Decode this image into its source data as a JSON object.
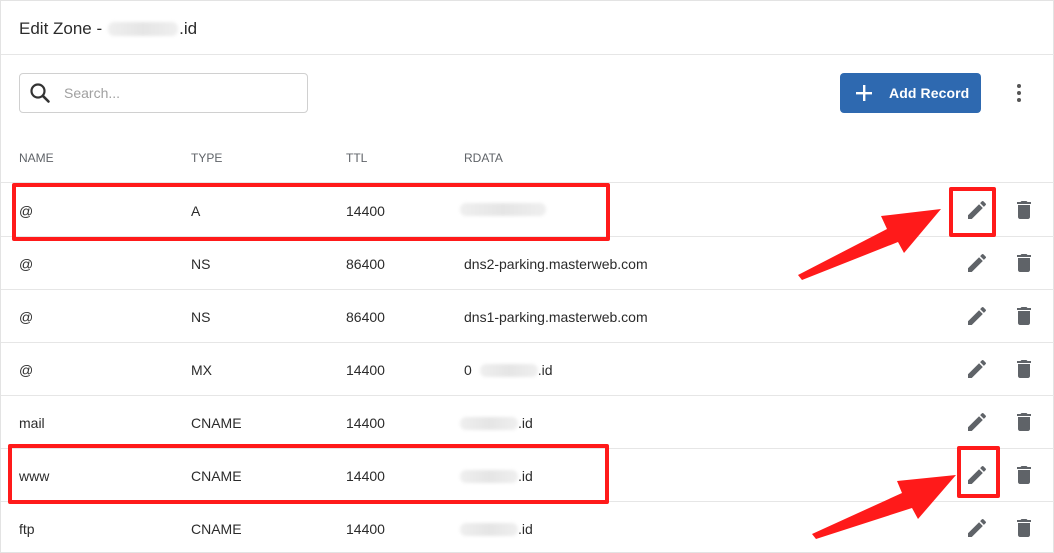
{
  "header": {
    "title_prefix": "Edit Zone - ",
    "title_suffix": ".id"
  },
  "search": {
    "placeholder": "Search...",
    "icon": "search-icon"
  },
  "toolbar": {
    "add_label": "Add Record",
    "add_icon": "plus-icon",
    "more_icon": "more-vert-icon",
    "accent": "#2e69b0"
  },
  "table": {
    "columns": {
      "name": "NAME",
      "type": "TYPE",
      "ttl": "TTL",
      "rdata": "RDATA"
    },
    "rows": [
      {
        "name": "@",
        "type": "A",
        "ttl": "14400",
        "rdata_prefix": "",
        "rdata_suffix": "",
        "rdata_redacted": true
      },
      {
        "name": "@",
        "type": "NS",
        "ttl": "86400",
        "rdata_prefix": "dns2-parking.masterweb.com",
        "rdata_suffix": "",
        "rdata_redacted": false
      },
      {
        "name": "@",
        "type": "NS",
        "ttl": "86400",
        "rdata_prefix": "dns1-parking.masterweb.com",
        "rdata_suffix": "",
        "rdata_redacted": false
      },
      {
        "name": "@",
        "type": "MX",
        "ttl": "14400",
        "rdata_prefix": "0",
        "rdata_suffix": ".id",
        "rdata_redacted": true
      },
      {
        "name": "mail",
        "type": "CNAME",
        "ttl": "14400",
        "rdata_prefix": "",
        "rdata_suffix": ".id",
        "rdata_redacted": true
      },
      {
        "name": "www",
        "type": "CNAME",
        "ttl": "14400",
        "rdata_prefix": "",
        "rdata_suffix": ".id",
        "rdata_redacted": true
      },
      {
        "name": "ftp",
        "type": "CNAME",
        "ttl": "14400",
        "rdata_prefix": "",
        "rdata_suffix": ".id",
        "rdata_redacted": true
      }
    ],
    "row_icons": {
      "edit": "pencil-icon",
      "delete": "trash-icon"
    }
  },
  "annotations": {
    "highlight_color": "#ff1a1a",
    "highlighted_rows": [
      0,
      5
    ]
  }
}
